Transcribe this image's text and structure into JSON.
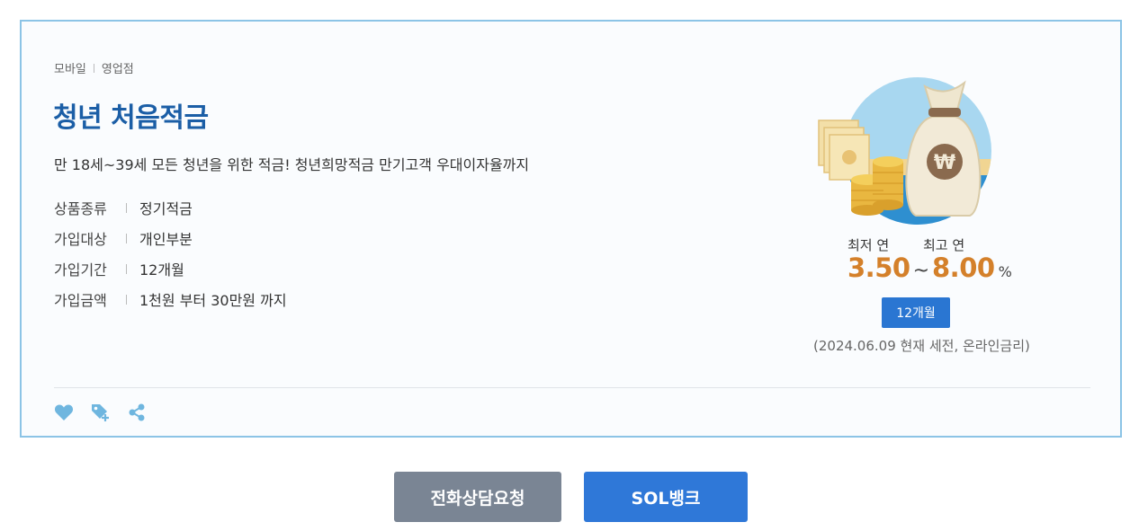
{
  "product": {
    "channels": [
      "모바일",
      "영업점"
    ],
    "title": "청년 처음적금",
    "description": "만 18세~39세 모든 청년을 위한 적금! 청년희망적금 만기고객 우대이자율까지",
    "info": [
      {
        "key": "상품종류",
        "value": "정기적금"
      },
      {
        "key": "가입대상",
        "value": "개인부분"
      },
      {
        "key": "가입기간",
        "value": "12개월"
      },
      {
        "key": "가입금액",
        "value": "1천원 부터 30만원 까지"
      }
    ],
    "rate": {
      "min_label": "최저 연",
      "max_label": "최고 연",
      "min_value": "3.50",
      "max_value": "8.00",
      "tilde": "~",
      "unit": "%",
      "term": "12개월",
      "note": "(2024.06.09 현재 세전, 온라인금리)"
    },
    "icons": [
      "heart-icon",
      "tag-add-icon",
      "share-icon"
    ]
  },
  "buttons": {
    "call": "전화상담요청",
    "sol": "SOL뱅크"
  },
  "colors": {
    "title": "#1b5ea6",
    "rate": "#d4802a",
    "badge": "#2a76d2",
    "call_button": "#7a8594",
    "sol_button": "#2f78d8",
    "card_border": "#8cc4e6"
  }
}
